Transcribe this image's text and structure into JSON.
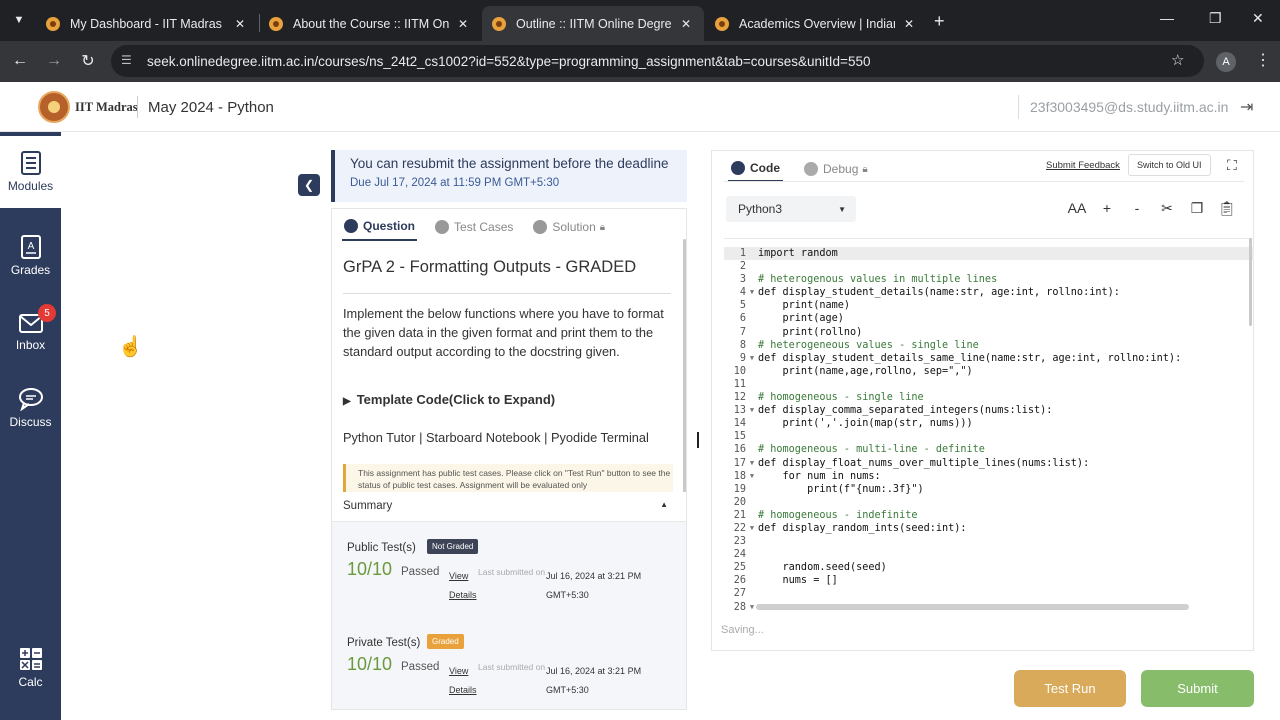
{
  "browser": {
    "tabs": [
      {
        "title": "My Dashboard - IIT Madras Onl",
        "active": false
      },
      {
        "title": "About the Course :: IITM Online",
        "active": false
      },
      {
        "title": "Outline :: IITM Online Degree",
        "active": true
      },
      {
        "title": "Academics Overview | Indian Ins",
        "active": false
      }
    ],
    "url": "seek.onlinedegree.iitm.ac.in/courses/ns_24t2_cs1002?id=552&type=programming_assignment&tab=courses&unitId=550",
    "profile_initial": "A"
  },
  "header": {
    "brand": "IIT Madras",
    "course": "May 2024 - Python",
    "email": "23f3003495@ds.study.iitm.ac.in"
  },
  "sidebar": {
    "items": [
      {
        "label": "Modules",
        "icon": "modules-icon",
        "active": true
      },
      {
        "label": "Grades",
        "icon": "grades-icon",
        "active": false
      },
      {
        "label": "Inbox",
        "icon": "inbox-icon",
        "active": false,
        "badge": "5"
      },
      {
        "label": "Discuss",
        "icon": "discuss-icon",
        "active": false
      },
      {
        "label": "Calc",
        "icon": "calc-icon",
        "active": false
      }
    ]
  },
  "notice": {
    "text": "You can resubmit the assignment before the deadline",
    "due": "Due Jul 17, 2024 at 11:59 PM GMT+5:30"
  },
  "question": {
    "tabs": [
      "Question",
      "Test Cases",
      "Solution"
    ],
    "title": "GrPA 2 - Formatting Outputs - GRADED",
    "description": "Implement the below functions where you have to format the given data in the given format and print them to the standard output according to the docstring given.",
    "template": "Template Code(Click to Expand)",
    "links": "Python Tutor | Starboard Notebook | Pyodide Terminal",
    "note": "This assignment has public test cases. Please click on \"Test Run\" button to see the status of public test cases. Assignment will be evaluated only"
  },
  "summary": {
    "title": "Summary",
    "public": {
      "label": "Public Test(s)",
      "badge": "Not Graded",
      "badge_color": "#3d4457",
      "score": "10/10",
      "status": "Passed",
      "view": "View Details",
      "last_submitted_label": "Last submitted on",
      "date": "Jul 16, 2024 at 3:21 PM GMT+5:30"
    },
    "private": {
      "label": "Private Test(s)",
      "badge": "Graded",
      "badge_color": "#e9a23b",
      "score": "10/10",
      "status": "Passed",
      "view": "View Details",
      "last_submitted_label": "Last submitted on",
      "date": "Jul 16, 2024 at 3:21 PM GMT+5:30"
    }
  },
  "editor": {
    "tabs": [
      "Code",
      "Debug"
    ],
    "submit_feedback": "Submit Feedback",
    "switch_old": "Switch to Old UI",
    "language": "Python3",
    "tools": [
      "AA",
      "+",
      "-",
      "cut",
      "copy",
      "paste"
    ],
    "saving": "Saving...",
    "lines": [
      {
        "n": "1",
        "t": "import random",
        "fold": false,
        "hl": true
      },
      {
        "n": "2",
        "t": "",
        "fold": false
      },
      {
        "n": "3",
        "t": "# heterogenous values in multiple lines",
        "fold": false,
        "comment": true
      },
      {
        "n": "4",
        "t": "def display_student_details(name:str, age:int, rollno:int):",
        "fold": true
      },
      {
        "n": "5",
        "t": "    print(name)",
        "fold": false
      },
      {
        "n": "6",
        "t": "    print(age)",
        "fold": false
      },
      {
        "n": "7",
        "t": "    print(rollno)",
        "fold": false
      },
      {
        "n": "8",
        "t": "# heterogeneous values - single line",
        "fold": false,
        "comment": true
      },
      {
        "n": "9",
        "t": "def display_student_details_same_line(name:str, age:int, rollno:int):",
        "fold": true
      },
      {
        "n": "10",
        "t": "    print(name,age,rollno, sep=\",\")",
        "fold": false
      },
      {
        "n": "11",
        "t": "",
        "fold": false
      },
      {
        "n": "12",
        "t": "# homogeneous - single line",
        "fold": false,
        "comment": true
      },
      {
        "n": "13",
        "t": "def display_comma_separated_integers(nums:list):",
        "fold": true
      },
      {
        "n": "14",
        "t": "    print(','.join(map(str, nums)))",
        "fold": false
      },
      {
        "n": "15",
        "t": "",
        "fold": false
      },
      {
        "n": "16",
        "t": "# homogeneous - multi-line - definite",
        "fold": false,
        "comment": true
      },
      {
        "n": "17",
        "t": "def display_float_nums_over_multiple_lines(nums:list):",
        "fold": true
      },
      {
        "n": "18",
        "t": "    for num in nums:",
        "fold": true
      },
      {
        "n": "19",
        "t": "        print(f\"{num:.3f}\")",
        "fold": false
      },
      {
        "n": "20",
        "t": "",
        "fold": false
      },
      {
        "n": "21",
        "t": "# homogeneous - indefinite",
        "fold": false,
        "comment": true
      },
      {
        "n": "22",
        "t": "def display_random_ints(seed:int):",
        "fold": true
      },
      {
        "n": "23",
        "t": "",
        "fold": false
      },
      {
        "n": "24",
        "t": "",
        "fold": false
      },
      {
        "n": "25",
        "t": "    random.seed(seed)",
        "fold": false
      },
      {
        "n": "26",
        "t": "    nums = []",
        "fold": false
      },
      {
        "n": "27",
        "t": "",
        "fold": false
      },
      {
        "n": "28",
        "t": "",
        "fold": true
      }
    ]
  },
  "actions": {
    "test_run": "Test Run",
    "submit": "Submit"
  }
}
